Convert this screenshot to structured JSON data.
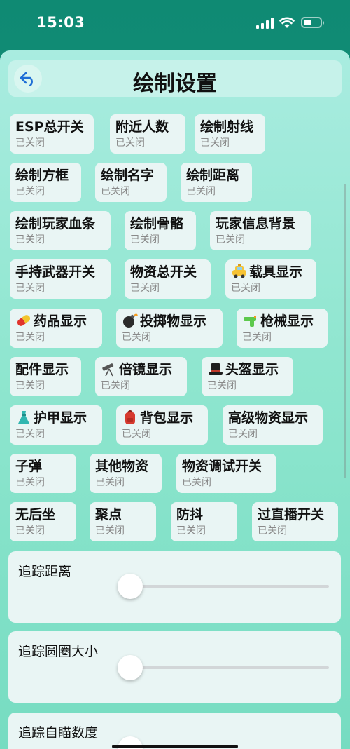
{
  "status": {
    "time": "15:03"
  },
  "header": {
    "title": "绘制设置"
  },
  "toggles": [
    {
      "label": "ESP总开关",
      "state": "已关闭",
      "icon": ""
    },
    {
      "label": "附近人数",
      "state": "已关闭",
      "icon": ""
    },
    {
      "label": "绘制射线",
      "state": "已关闭",
      "icon": ""
    },
    {
      "label": "绘制方框",
      "state": "已关闭",
      "icon": ""
    },
    {
      "label": "绘制名字",
      "state": "已关闭",
      "icon": ""
    },
    {
      "label": "绘制距离",
      "state": "已关闭",
      "icon": ""
    },
    {
      "label": "绘制玩家血条",
      "state": "已关闭",
      "icon": ""
    },
    {
      "label": "绘制骨骼",
      "state": "已关闭",
      "icon": ""
    },
    {
      "label": "玩家信息背景",
      "state": "已关闭",
      "icon": ""
    },
    {
      "label": "手持武器开关",
      "state": "已关闭",
      "icon": ""
    },
    {
      "label": "物资总开关",
      "state": "已关闭",
      "icon": ""
    },
    {
      "label": "载具显示",
      "state": "已关闭",
      "icon": "taxi-icon"
    },
    {
      "label": "药品显示",
      "state": "已关闭",
      "icon": "pill-icon"
    },
    {
      "label": "投掷物显示",
      "state": "已关闭",
      "icon": "bomb-icon"
    },
    {
      "label": "枪械显示",
      "state": "已关闭",
      "icon": "water-pistol-icon"
    },
    {
      "label": "配件显示",
      "state": "已关闭",
      "icon": ""
    },
    {
      "label": "倍镜显示",
      "state": "已关闭",
      "icon": "telescope-icon"
    },
    {
      "label": "头盔显示",
      "state": "已关闭",
      "icon": "top-hat-icon"
    },
    {
      "label": "护甲显示",
      "state": "已关闭",
      "icon": "dress-icon"
    },
    {
      "label": "背包显示",
      "state": "已关闭",
      "icon": "backpack-icon"
    },
    {
      "label": "高级物资显示",
      "state": "已关闭",
      "icon": ""
    },
    {
      "label": "子弹",
      "state": "已关闭",
      "icon": ""
    },
    {
      "label": "其他物资",
      "state": "已关闭",
      "icon": ""
    },
    {
      "label": "物资调试开关",
      "state": "已关闭",
      "icon": ""
    },
    {
      "label": "无后坐",
      "state": "已关闭",
      "icon": ""
    },
    {
      "label": "聚点",
      "state": "已关闭",
      "icon": ""
    },
    {
      "label": "防抖",
      "state": "已关闭",
      "icon": ""
    },
    {
      "label": "过直播开关",
      "state": "已关闭",
      "icon": ""
    }
  ],
  "sliders": [
    {
      "label": "追踪距离",
      "value_fraction": 0.0
    },
    {
      "label": "追踪圆圈大小",
      "value_fraction": 0.0
    },
    {
      "label": "追踪自瞄数度",
      "value_fraction": 0.0
    }
  ],
  "colors": {
    "accent": "#0f8a73",
    "tile": "#e9f5f4",
    "back_icon": "#1f6fd6"
  }
}
